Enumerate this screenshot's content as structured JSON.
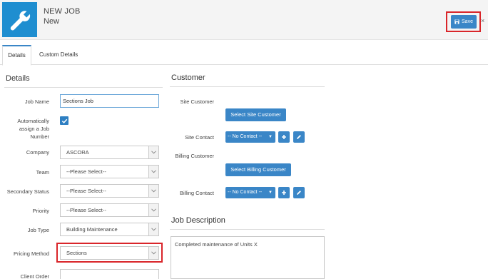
{
  "header": {
    "type_label": "NEW JOB",
    "status_label": "New",
    "icon": "wrench-icon",
    "save_label": "Save",
    "close_symbol": "×"
  },
  "tabs": [
    {
      "label": "Details",
      "active": true
    },
    {
      "label": "Custom Details",
      "active": false
    }
  ],
  "details": {
    "title": "Details",
    "job_name": {
      "label": "Job Name",
      "value": "Sections Job"
    },
    "auto_number": {
      "label_lines": [
        "Automatically",
        "assign a Job",
        "Number"
      ],
      "checked": true
    },
    "company": {
      "label": "Company",
      "value": "ASCORA"
    },
    "team": {
      "label": "Team",
      "value": "--Please Select--"
    },
    "secondary_status": {
      "label": "Secondary Status",
      "value": "--Please Select--"
    },
    "priority": {
      "label": "Priority",
      "value": "--Please Select--"
    },
    "job_type": {
      "label": "Job Type",
      "value": "Building Maintenance"
    },
    "pricing_method": {
      "label": "Pricing Method",
      "value": "Sections"
    },
    "client_order": {
      "label": "Client Order",
      "value": ""
    }
  },
  "customer": {
    "title": "Customer",
    "site_customer_label": "Site Customer",
    "select_site_customer": "Select Site Customer",
    "site_contact_label": "Site Contact",
    "site_contact_value": "-- No Contact --",
    "billing_customer_label": "Billing Customer",
    "select_billing_customer": "Select Billing Customer",
    "billing_contact_label": "Billing Contact",
    "billing_contact_value": "-- No Contact --"
  },
  "job_description": {
    "title": "Job Description",
    "value": "Completed maintenance of Units X"
  },
  "colors": {
    "accent": "#3a86c7",
    "header_icon_bg": "#1f8ed0",
    "highlight": "#d9252a"
  }
}
